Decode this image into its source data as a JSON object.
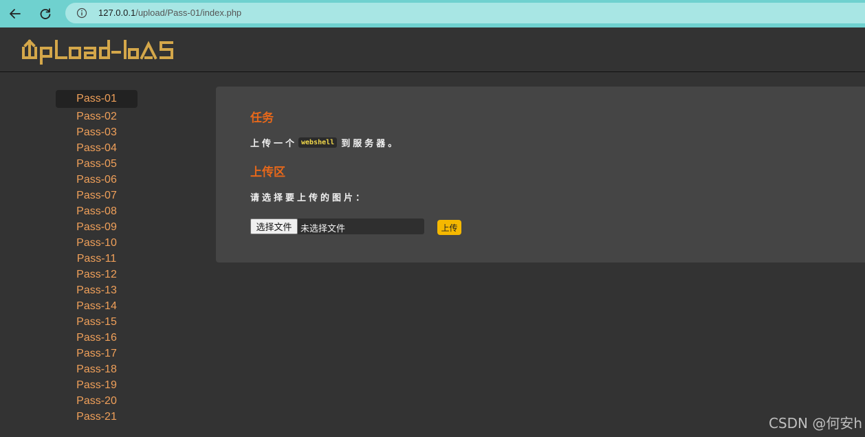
{
  "browser": {
    "url_host": "127.0.0.1",
    "url_path": "/upload/Pass-01/index.php"
  },
  "header": {
    "logo_text": "UpLoad-labs",
    "logo_color": "#d4a74a"
  },
  "sidebar": {
    "items": [
      {
        "label": "Pass-01",
        "active": true
      },
      {
        "label": "Pass-02"
      },
      {
        "label": "Pass-03"
      },
      {
        "label": "Pass-04"
      },
      {
        "label": "Pass-05"
      },
      {
        "label": "Pass-06"
      },
      {
        "label": "Pass-07"
      },
      {
        "label": "Pass-08"
      },
      {
        "label": "Pass-09"
      },
      {
        "label": "Pass-10"
      },
      {
        "label": "Pass-11"
      },
      {
        "label": "Pass-12"
      },
      {
        "label": "Pass-13"
      },
      {
        "label": "Pass-14"
      },
      {
        "label": "Pass-15"
      },
      {
        "label": "Pass-16"
      },
      {
        "label": "Pass-17"
      },
      {
        "label": "Pass-18"
      },
      {
        "label": "Pass-19"
      },
      {
        "label": "Pass-20"
      },
      {
        "label": "Pass-21"
      }
    ],
    "link_color": "#f0a05a"
  },
  "main": {
    "task_title": "任务",
    "task_text_before": "上传一个",
    "task_code": "webshell",
    "task_text_after": "到服务器。",
    "upload_title": "上传区",
    "choose_label": "请选择要上传的图片：",
    "file_button_label": "选择文件",
    "file_status": "未选择文件",
    "submit_label": "上传",
    "accent_color": "#e8681a",
    "submit_color": "#f5b800"
  },
  "watermark": "CSDN @何安h"
}
